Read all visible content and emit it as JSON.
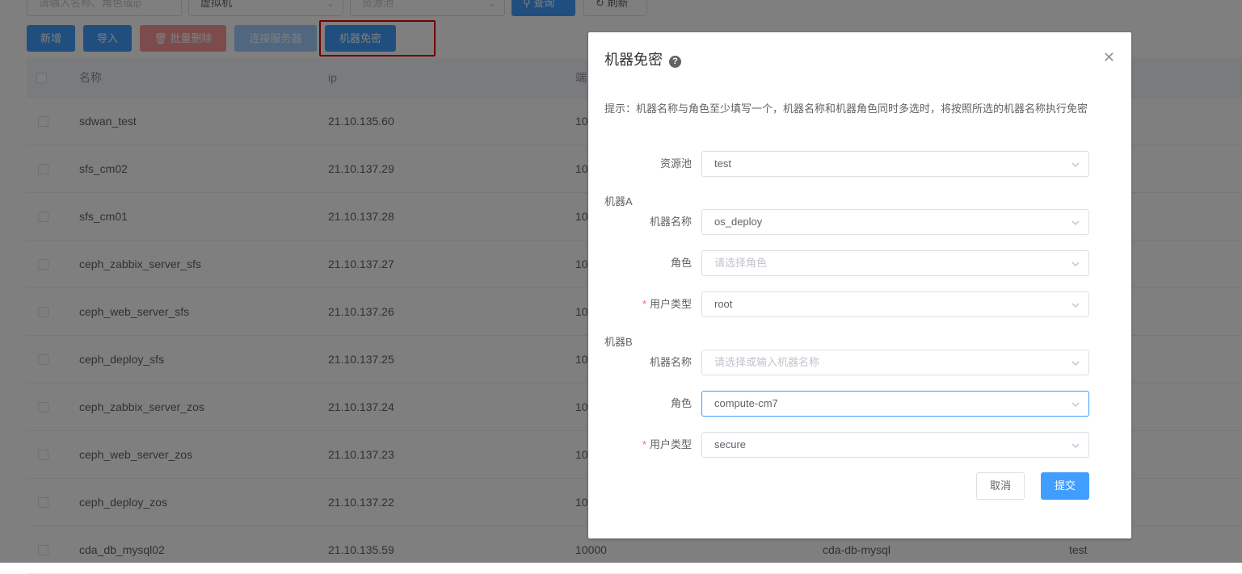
{
  "filters": {
    "name_placeholder": "请输入名称、角色或ip",
    "type_value": "虚拟机",
    "pool_placeholder": "资源池",
    "query_label": "查询",
    "refresh_label": "刷新"
  },
  "toolbar": {
    "add_label": "新增",
    "import_label": "导入",
    "batch_delete_label": "批量删除",
    "connect_label": "连接服务器",
    "passwordless_label": "机器免密"
  },
  "table": {
    "headers": {
      "name": "名称",
      "ip": "ip",
      "port": "端"
    },
    "rows": [
      {
        "name": "sdwan_test",
        "ip": "21.10.135.60",
        "port": "10",
        "role": "",
        "pool": ""
      },
      {
        "name": "sfs_cm02",
        "ip": "21.10.137.29",
        "port": "10",
        "role": "",
        "pool": ""
      },
      {
        "name": "sfs_cm01",
        "ip": "21.10.137.28",
        "port": "10",
        "role": "",
        "pool": ""
      },
      {
        "name": "ceph_zabbix_server_sfs",
        "ip": "21.10.137.27",
        "port": "10",
        "role": "",
        "pool": ""
      },
      {
        "name": "ceph_web_server_sfs",
        "ip": "21.10.137.26",
        "port": "10",
        "role": "",
        "pool": ""
      },
      {
        "name": "ceph_deploy_sfs",
        "ip": "21.10.137.25",
        "port": "10",
        "role": "",
        "pool": ""
      },
      {
        "name": "ceph_zabbix_server_zos",
        "ip": "21.10.137.24",
        "port": "10",
        "role": "",
        "pool": ""
      },
      {
        "name": "ceph_web_server_zos",
        "ip": "21.10.137.23",
        "port": "10",
        "role": "",
        "pool": ""
      },
      {
        "name": "ceph_deploy_zos",
        "ip": "21.10.137.22",
        "port": "10",
        "role": "",
        "pool": ""
      },
      {
        "name": "cda_db_mysql02",
        "ip": "21.10.135.59",
        "port": "10000",
        "role": "cda-db-mysql",
        "pool": "test"
      }
    ]
  },
  "dialog": {
    "title": "机器免密",
    "tip": "提示：机器名称与角色至少填写一个，机器名称和机器角色同时多选时，将按照所选的机器名称执行免密",
    "pool_label": "资源池",
    "pool_value": "test",
    "machine_a": {
      "group_label": "机器A",
      "name_label": "机器名称",
      "name_value": "os_deploy",
      "role_label": "角色",
      "role_placeholder": "请选择角色",
      "usertype_label": "用户类型",
      "usertype_value": "root"
    },
    "machine_b": {
      "group_label": "机器B",
      "name_label": "机器名称",
      "name_placeholder": "请选择或输入机器名称",
      "role_label": "角色",
      "role_value": "compute-cm7",
      "usertype_label": "用户类型",
      "usertype_value": "secure"
    },
    "cancel_label": "取消",
    "submit_label": "提交"
  },
  "colors": {
    "primary": "#409eff",
    "highlight": "#e60000",
    "required": "#f56c6c"
  }
}
